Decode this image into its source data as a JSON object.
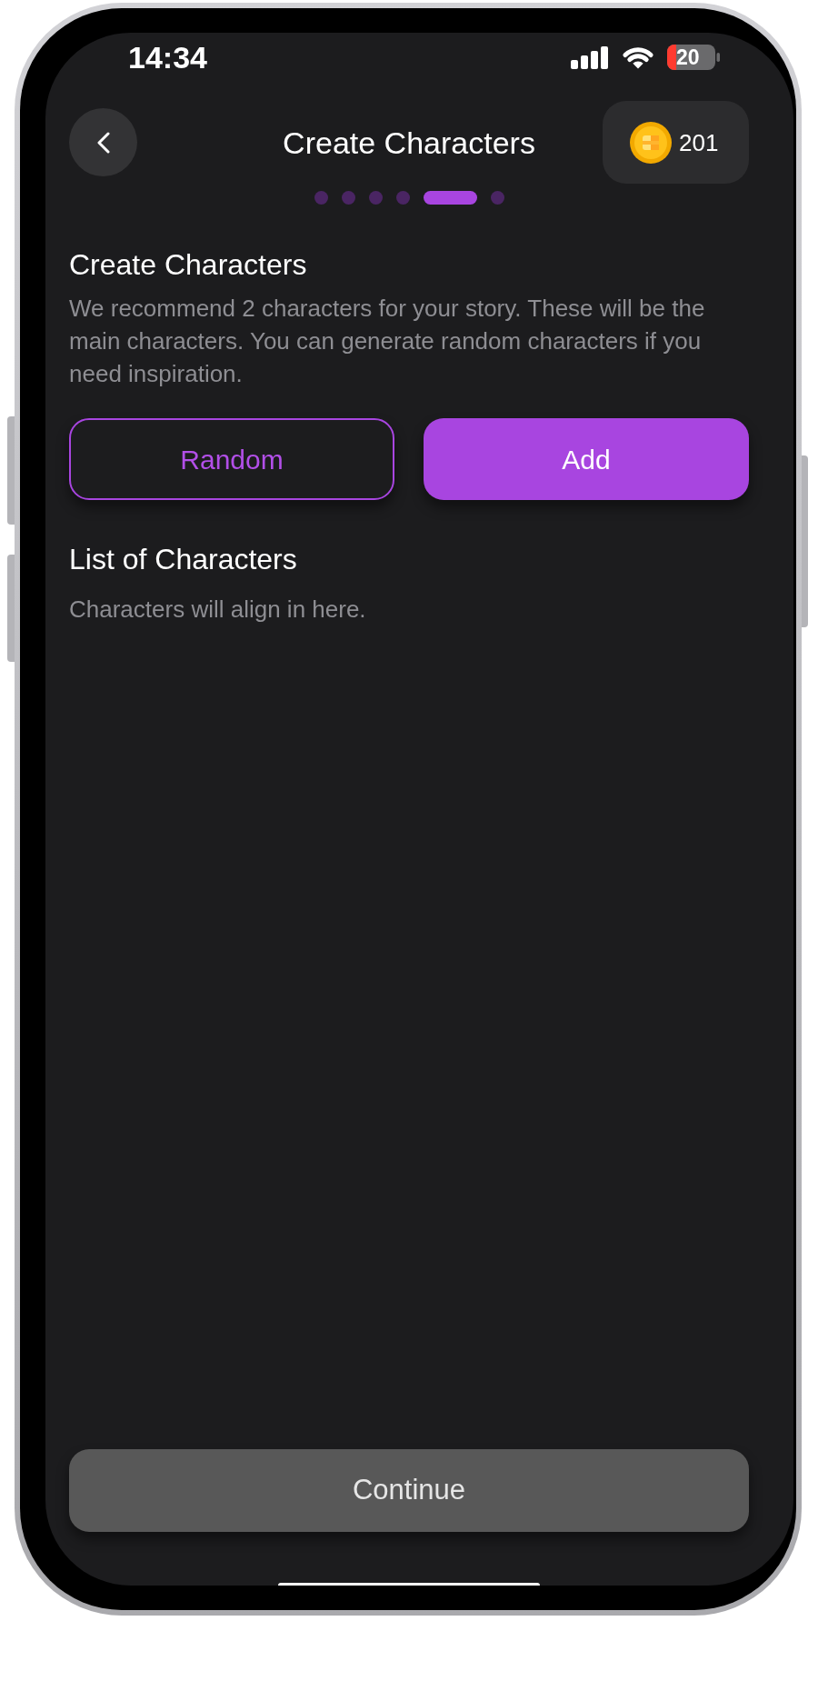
{
  "status_bar": {
    "time": "14:34",
    "battery": "20"
  },
  "header": {
    "title": "Create Characters",
    "coins": "201"
  },
  "progress_dots": [
    {
      "selected": false
    },
    {
      "selected": false
    },
    {
      "selected": false
    },
    {
      "selected": false
    },
    {
      "selected": true
    },
    {
      "selected": false
    }
  ],
  "intro": {
    "heading": "Create Characters",
    "description": "We recommend 2 characters for your story. These will be the main characters. You can generate random characters if you need inspiration."
  },
  "actions": [
    {
      "label": "Random",
      "kind": "outline"
    },
    {
      "label": "Add",
      "kind": "filled"
    }
  ],
  "character_list": {
    "heading": "List of Characters",
    "empty_text": "Characters will align in here."
  },
  "continue_button": {
    "label": "Continue",
    "disabled": true
  }
}
